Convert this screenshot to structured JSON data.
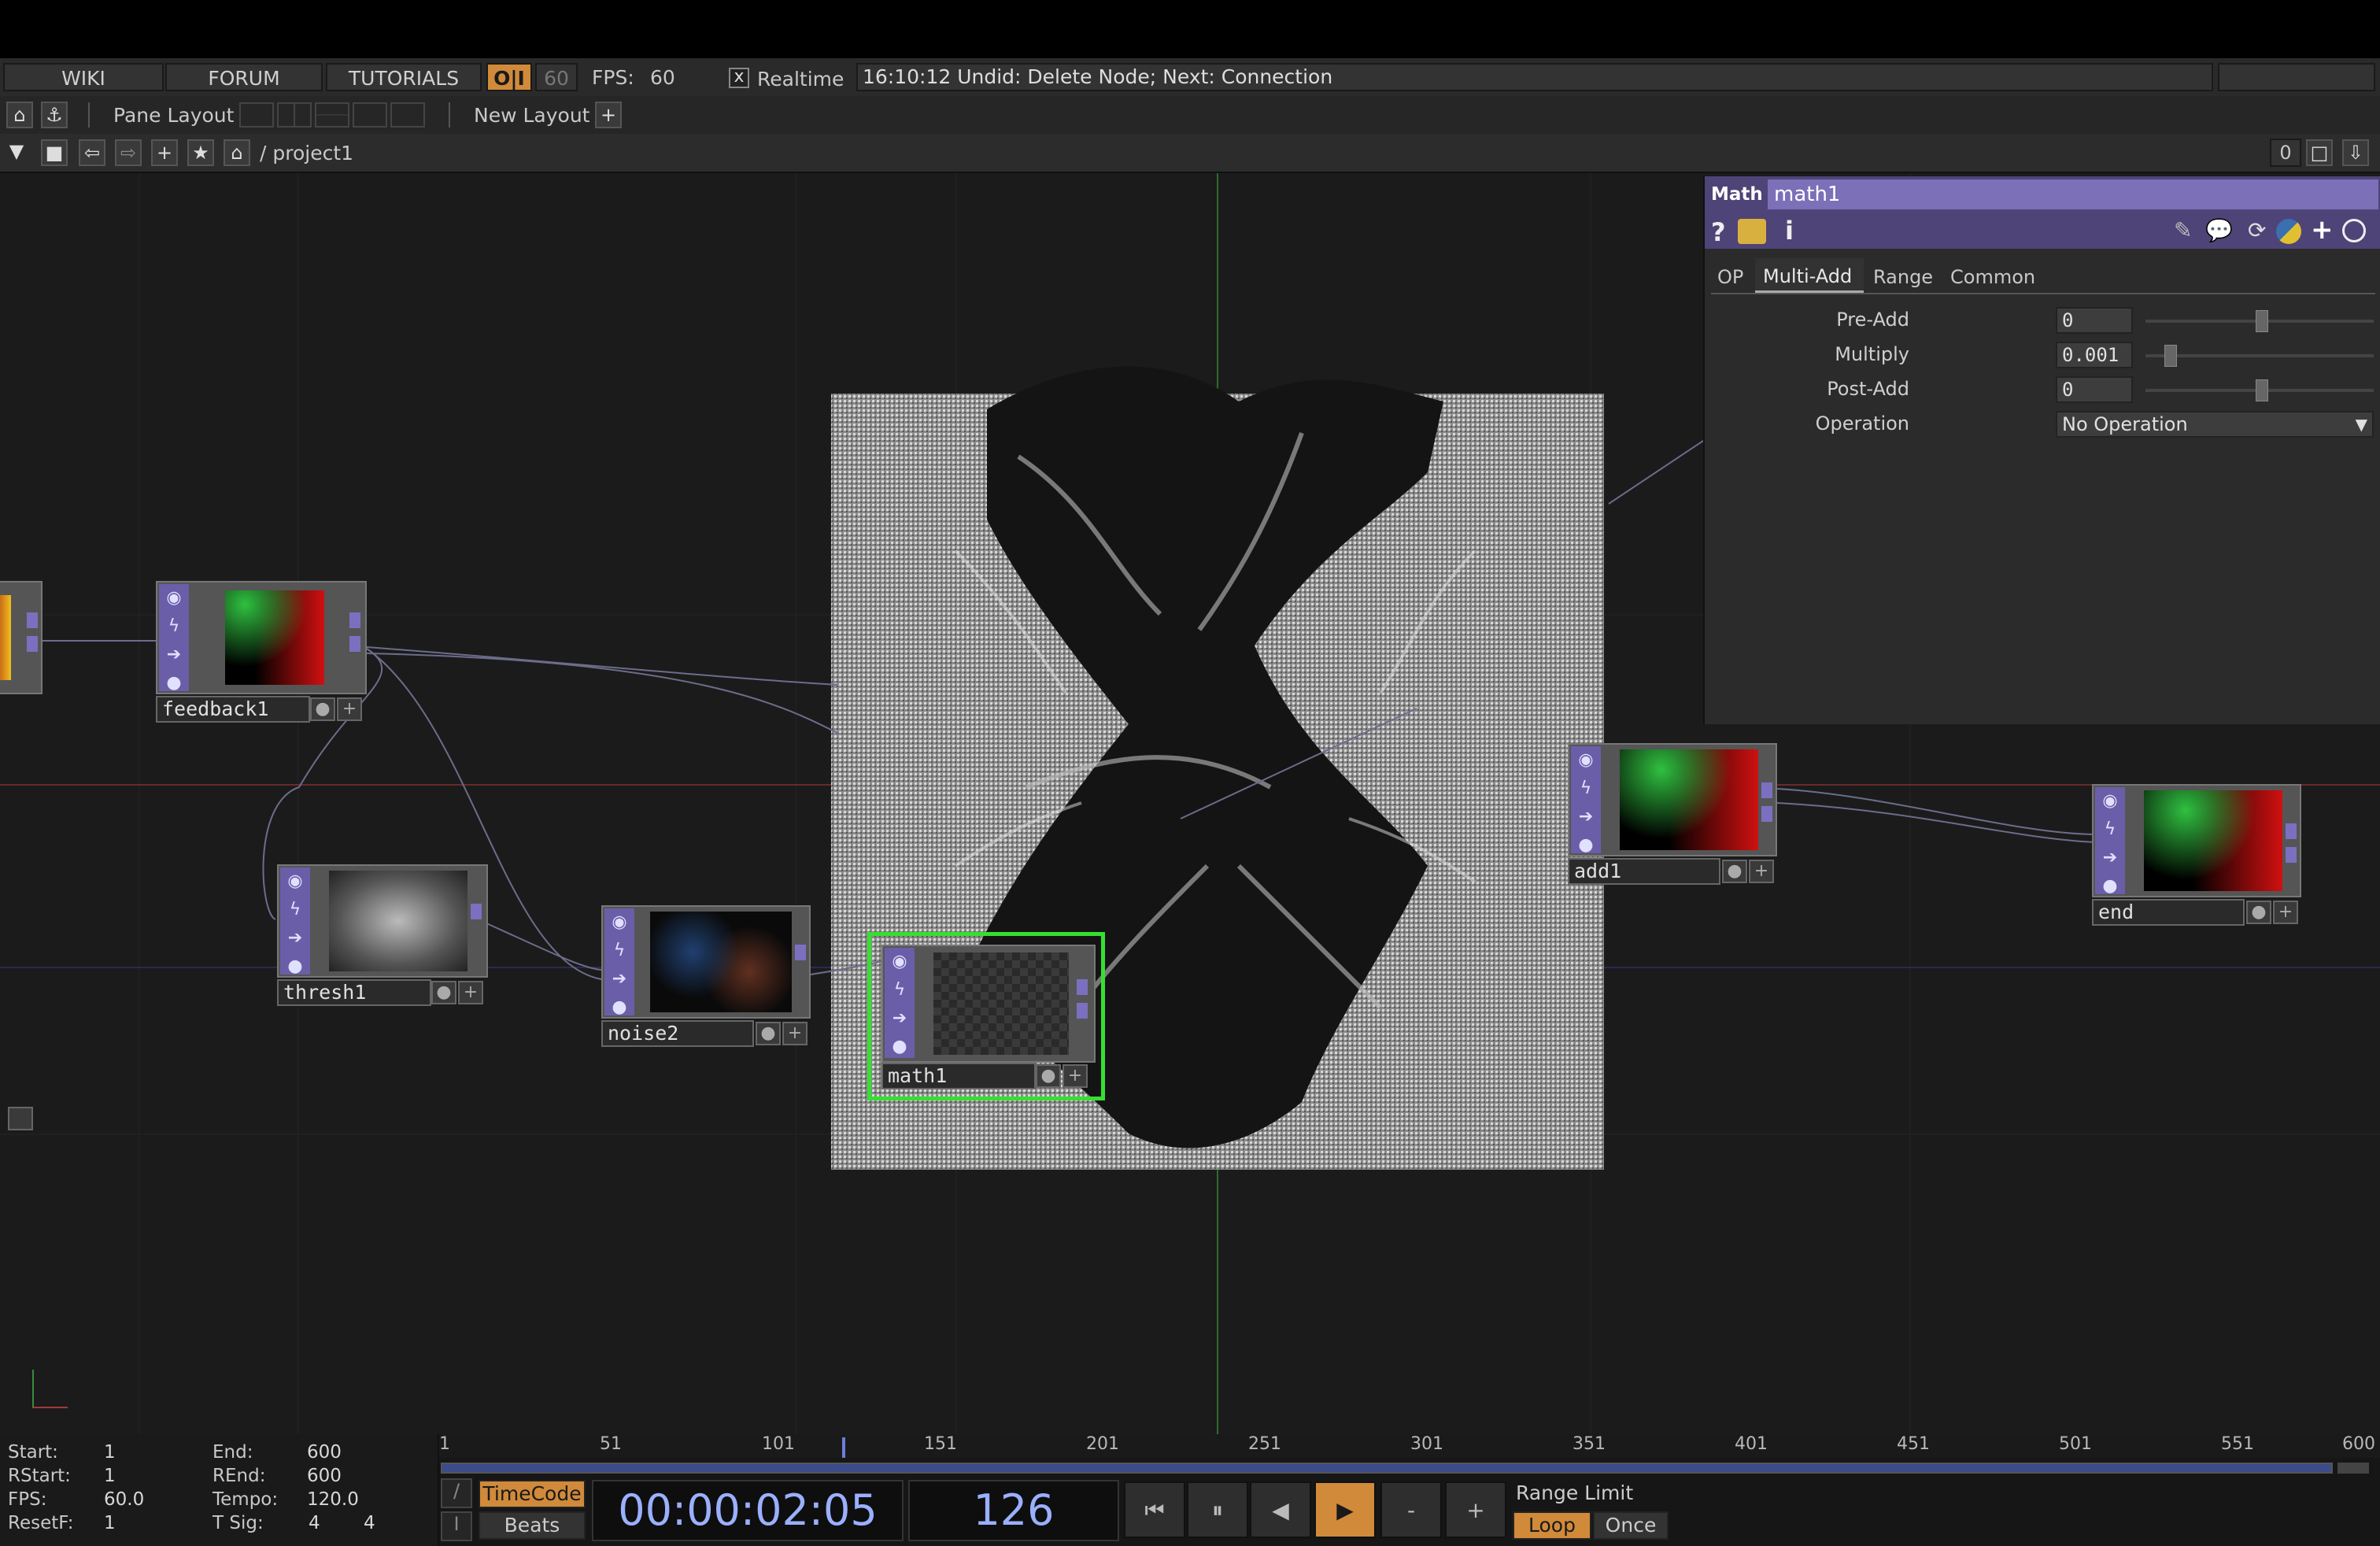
{
  "menu": {
    "wiki": "WIKI",
    "forum": "FORUM",
    "tutorials": "TUTORIALS",
    "oi": "O|I",
    "fps_limit": "60",
    "fps_label": "FPS:",
    "fps_value": "60",
    "realtime_check": "x",
    "realtime_label": "Realtime",
    "status": "16:10:12 Undid: Delete Node; Next: Connection"
  },
  "panebar": {
    "pane_layout": "Pane Layout",
    "new_layout": "New Layout",
    "plus": "+"
  },
  "pathbar": {
    "path": "/ project1",
    "counter": "0"
  },
  "nodes": {
    "feedback1": "feedback1",
    "thresh1": "thresh1",
    "noise2": "noise2",
    "math1": "math1",
    "add1": "add1",
    "end": "end"
  },
  "params": {
    "op_type": "Math",
    "op_name": "math1",
    "tabs": [
      "OP",
      "Multi-Add",
      "Range",
      "Common"
    ],
    "active_tab": "Multi-Add",
    "rows": [
      {
        "label": "Pre-Add",
        "value": "0"
      },
      {
        "label": "Multiply",
        "value": "0.001"
      },
      {
        "label": "Post-Add",
        "value": "0"
      }
    ],
    "operation_label": "Operation",
    "operation_value": "No Operation"
  },
  "timeline": {
    "start_label": "Start:",
    "start": "1",
    "end_label": "End:",
    "end": "600",
    "rstart_label": "RStart:",
    "rstart": "1",
    "rend_label": "REnd:",
    "rend": "600",
    "fps_label": "FPS:",
    "fps": "60.0",
    "tempo_label": "Tempo:",
    "tempo": "120.0",
    "resetf_label": "ResetF:",
    "resetf": "1",
    "tsig_label": "T Sig:",
    "tsig_a": "4",
    "tsig_b": "4",
    "ticks": [
      "1",
      "51",
      "101",
      "151",
      "201",
      "251",
      "301",
      "351",
      "401",
      "451",
      "501",
      "551",
      "600"
    ],
    "timecode_btn": "TimeCode",
    "beats_btn": "Beats",
    "timecode": "00:00:02:05",
    "frame": "126",
    "range_limit": "Range Limit",
    "loop": "Loop",
    "once": "Once",
    "minus": "-",
    "plus": "+"
  },
  "colors": {
    "accent_orange": "#d08a3a",
    "node_purple": "#6b5ea8",
    "selected_green": "#35e030",
    "timecode_blue": "#9ab0ff"
  }
}
